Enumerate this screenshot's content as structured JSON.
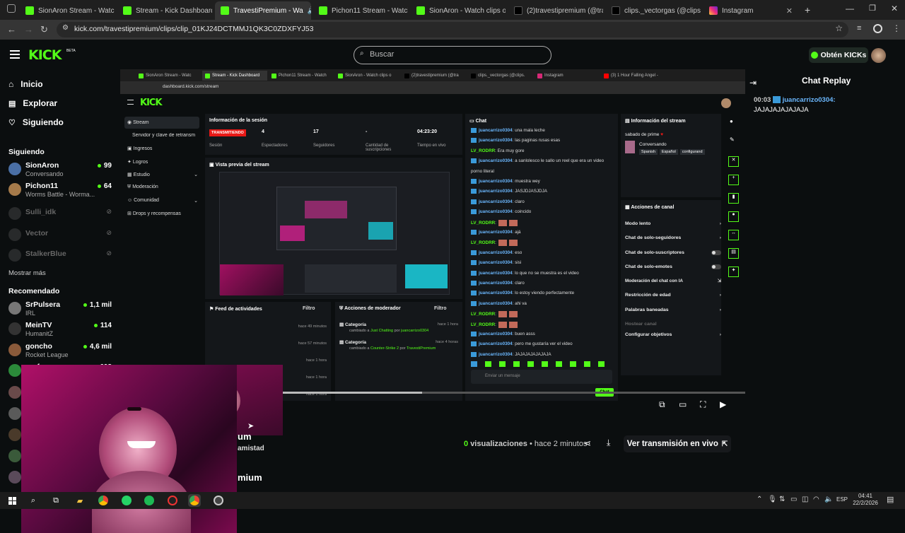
{
  "browser": {
    "tabs": [
      {
        "title": "SionAron Stream - Watch",
        "color": "#53fc18"
      },
      {
        "title": "Stream - Kick Dashboard",
        "color": "#53fc18"
      },
      {
        "title": "TravestiPremium - Wa",
        "color": "#53fc18",
        "active": true
      },
      {
        "title": "Pichon11 Stream - Watch",
        "color": "#53fc18"
      },
      {
        "title": "SionAron - Watch clips o",
        "color": "#53fc18"
      },
      {
        "title": "(2)travestipremium (@tra",
        "color": "#111111"
      },
      {
        "title": "clips._vectorgas (@clips.",
        "color": "#111111"
      },
      {
        "title": "Instagram",
        "color": "#d62976"
      }
    ],
    "url": "kick.com/travestipremium/clips/clip_01KJ24DCTMMJ1QK3C0ZDXFYJ53"
  },
  "header": {
    "logo": "KICK",
    "logo_tag": "BETA",
    "search_placeholder": "Buscar",
    "kicks_button": "Obtén KICKs"
  },
  "sidebar": {
    "nav": [
      {
        "label": "Inicio",
        "icon": "home-icon"
      },
      {
        "label": "Explorar",
        "icon": "browse-icon"
      },
      {
        "label": "Siguiendo",
        "icon": "heart-icon"
      }
    ],
    "following_title": "Siguiendo",
    "following": [
      {
        "name": "SionAron",
        "sub": "Conversando",
        "count": "99",
        "live": true
      },
      {
        "name": "Pichon11",
        "sub": "Worms Battle - Worma...",
        "count": "64",
        "live": true
      },
      {
        "name": "Sulli_idk",
        "live": false
      },
      {
        "name": "Vector",
        "live": false
      },
      {
        "name": "StalkerBlue",
        "live": false
      }
    ],
    "show_more": "Mostrar más",
    "recommended_title": "Recomendado",
    "recommended": [
      {
        "name": "SrPulsera",
        "sub": "IRL",
        "count": "1,1 mil"
      },
      {
        "name": "MeinTV",
        "sub": "HumanitZ",
        "count": "114"
      },
      {
        "name": "goncho",
        "sub": "Rocket League",
        "count": "4,6 mil"
      },
      {
        "name": "grafo",
        "sub": "",
        "count": "698"
      }
    ]
  },
  "inner": {
    "tabs": [
      "SionAron Stream - Watc",
      "Stream - Kick Dashboard",
      "Pichon11 Stream - Watch",
      "SionAron - Watch clips o",
      "(2)travestipremium (@tra",
      "clips._vectorgas (@clips.",
      "Instagram",
      "(3) 1 Hour Falling Angel -"
    ],
    "url": "dashboard.kick.com/stream",
    "logo": "KICK",
    "menu": [
      "Stream",
      "Servidor y clave de retransm",
      "Ingresos",
      "Logros",
      "Estudio",
      "Moderación",
      "Comunidad",
      "Drops y recompensas"
    ],
    "session": {
      "title": "Información de la sesión",
      "status": "TRANSMITIENDO",
      "status_label": "Sesión",
      "viewers": "4",
      "viewers_label": "Espectadores",
      "followers": "17",
      "followers_label": "Seguidores",
      "subs": "-",
      "subs_label": "Cantidad de suscripciones",
      "time": "04:23:20",
      "time_label": "Tiempo en vivo"
    },
    "preview_title": "Vista previa del stream",
    "activity": {
      "title": "Feed de actividades",
      "filter": "Filtro",
      "times": [
        "hace 49 minutos",
        "hace 57 minutos",
        "hace 1 hora",
        "hace 1 hora",
        "hace 1 hora"
      ]
    },
    "modactions": {
      "title": "Acciones de moderador",
      "filter": "Filtro",
      "items": [
        {
          "title": "Categoría",
          "desc": "cambiado a",
          "target": "Just Chatting",
          "by": "por",
          "user": "juancarrizo0304",
          "time": "hace 1 hora"
        },
        {
          "title": "Categoría",
          "desc": "cambiado a",
          "target": "Counter-Strike 2",
          "by": "por",
          "user": "TravestiPremium",
          "time": "hace 4 horas"
        }
      ]
    },
    "chat": {
      "title": "Chat",
      "lines": [
        {
          "user": "juancarrizo0304",
          "msg": ": una mala leche"
        },
        {
          "user": "juancarrizo0304",
          "msg": ": las paginas rusas esas"
        },
        {
          "user": "LV_RODRR",
          "msg": ": Era muy gore"
        },
        {
          "user": "juancarrizo0304",
          "msg": ": a sanlolesco le sallo un reel que era un video"
        },
        {
          "user": "",
          "msg": "porno literal"
        },
        {
          "user": "juancarrizo0304",
          "msg": ": muestra wey"
        },
        {
          "user": "juancarrizo0304",
          "msg": ": JASJDJASJDJA"
        },
        {
          "user": "juancarrizo0304",
          "msg": ": claro"
        },
        {
          "user": "juancarrizo0304",
          "msg": ": coincido"
        },
        {
          "user": "LV_RODRR",
          "msg": ":"
        },
        {
          "user": "juancarrizo0304",
          "msg": ": ajá"
        },
        {
          "user": "LV_RODRR",
          "msg": ":"
        },
        {
          "user": "juancarrizo0304",
          "msg": ": eso"
        },
        {
          "user": "juancarrizo0304",
          "msg": ": sisi"
        },
        {
          "user": "juancarrizo0304",
          "msg": ": lo que no se muestra es el video"
        },
        {
          "user": "juancarrizo0304",
          "msg": ": claro"
        },
        {
          "user": "juancarrizo0304",
          "msg": ": lo estoy viendo perfectamente"
        },
        {
          "user": "juancarrizo0304",
          "msg": ": ahi va"
        },
        {
          "user": "LV_RODRR",
          "msg": ":"
        },
        {
          "user": "LV_RODRR",
          "msg": ":"
        },
        {
          "user": "juancarrizo0304",
          "msg": ": buen asss"
        },
        {
          "user": "juancarrizo0304",
          "msg": ": pero me gustaría ver el video"
        },
        {
          "user": "juancarrizo0304",
          "msg": ": JAJAJAJAJAJAJA"
        }
      ],
      "input_placeholder": "Enviar un mensaje",
      "send": "Chat"
    },
    "stream_info": {
      "title": "Información del stream",
      "stream_title": "sabado de prime",
      "category": "Conversando",
      "tags": [
        "Spanish",
        "Español",
        "configurand"
      ]
    },
    "channel_actions": {
      "title": "Acciones de canal",
      "items": [
        "Modo lento",
        "Chat de solo-seguidores",
        "Chat de solo-suscriptores",
        "Chat de solo-emotes",
        "Moderación del chat con IA",
        "Restricción de edad",
        "Palabras baneadas",
        "Hostear canal",
        "Configurar objetivos"
      ]
    }
  },
  "clip": {
    "title_fragment": "um",
    "friend_fragment": "amistad",
    "channel_fragment": "mium",
    "views_count": "0",
    "views_label": "visualizaciones",
    "time": "hace 2 minutos",
    "live_button": "Ver transmisión en vivo"
  },
  "chat_replay": {
    "title": "Chat Replay",
    "messages": [
      {
        "time": "00:03",
        "user": "juancarrizo0304:",
        "text": "JAJAJAJAJAJAJA"
      }
    ]
  },
  "taskbar": {
    "lang": "ESP",
    "time": "04:41",
    "date": "22/2/2026"
  },
  "colors": {
    "accent": "#53fc18",
    "bg": "#0b0e0f",
    "live_red": "#e91916"
  }
}
